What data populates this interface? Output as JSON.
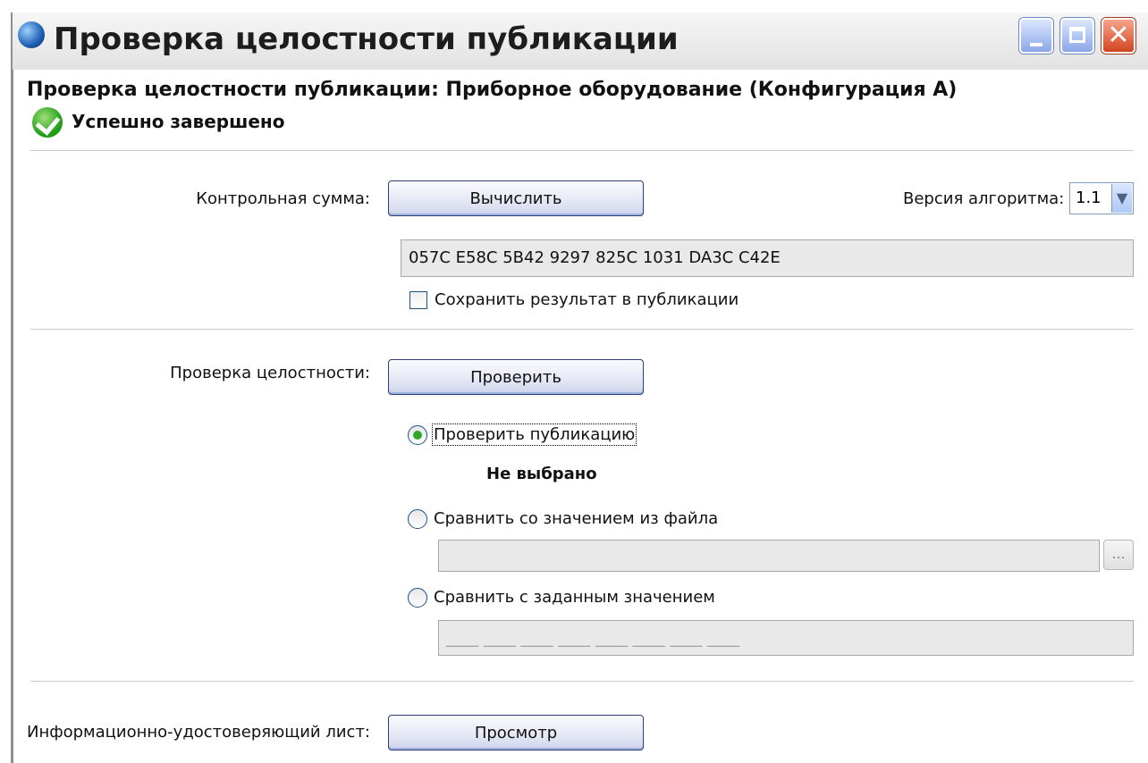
{
  "window": {
    "title": "Проверка целостности публикации",
    "buttons": {
      "minimize": "_",
      "maximize": "□",
      "close": "✕"
    }
  },
  "header": {
    "title": "Проверка целостности публикации: Приборное оборудование (Конфигурация А)",
    "status": "Успешно завершено",
    "status_icon": "check-circle-icon"
  },
  "checksum": {
    "label": "Контрольная сумма:",
    "button": "Вычислить",
    "algo_label": "Версия алгоритма:",
    "algo_value": "1.1",
    "value": "057C E58C 5B42 9297 825C 1031 DA3C C42E",
    "save_label": "Сохранить результат в публикации",
    "save_checked": false
  },
  "integrity": {
    "label": "Проверка целостности:",
    "button": "Проверить",
    "options": [
      {
        "label": "Проверить публикацию",
        "selected": true
      },
      {
        "label": "Сравнить со значением из файла",
        "selected": false
      },
      {
        "label": "Сравнить с заданным значением",
        "selected": false
      }
    ],
    "selection_status": "Не выбрано",
    "file_path": "",
    "browse_label": "...",
    "manual_value": "____ ____ ____ ____ ____ ____ ____ ____"
  },
  "certificate": {
    "label": "Информационно-удостоверяющий лист:",
    "button": "Просмотр"
  },
  "colors": {
    "accent": "#34a52b",
    "title_blue": "#1d5fb3"
  }
}
